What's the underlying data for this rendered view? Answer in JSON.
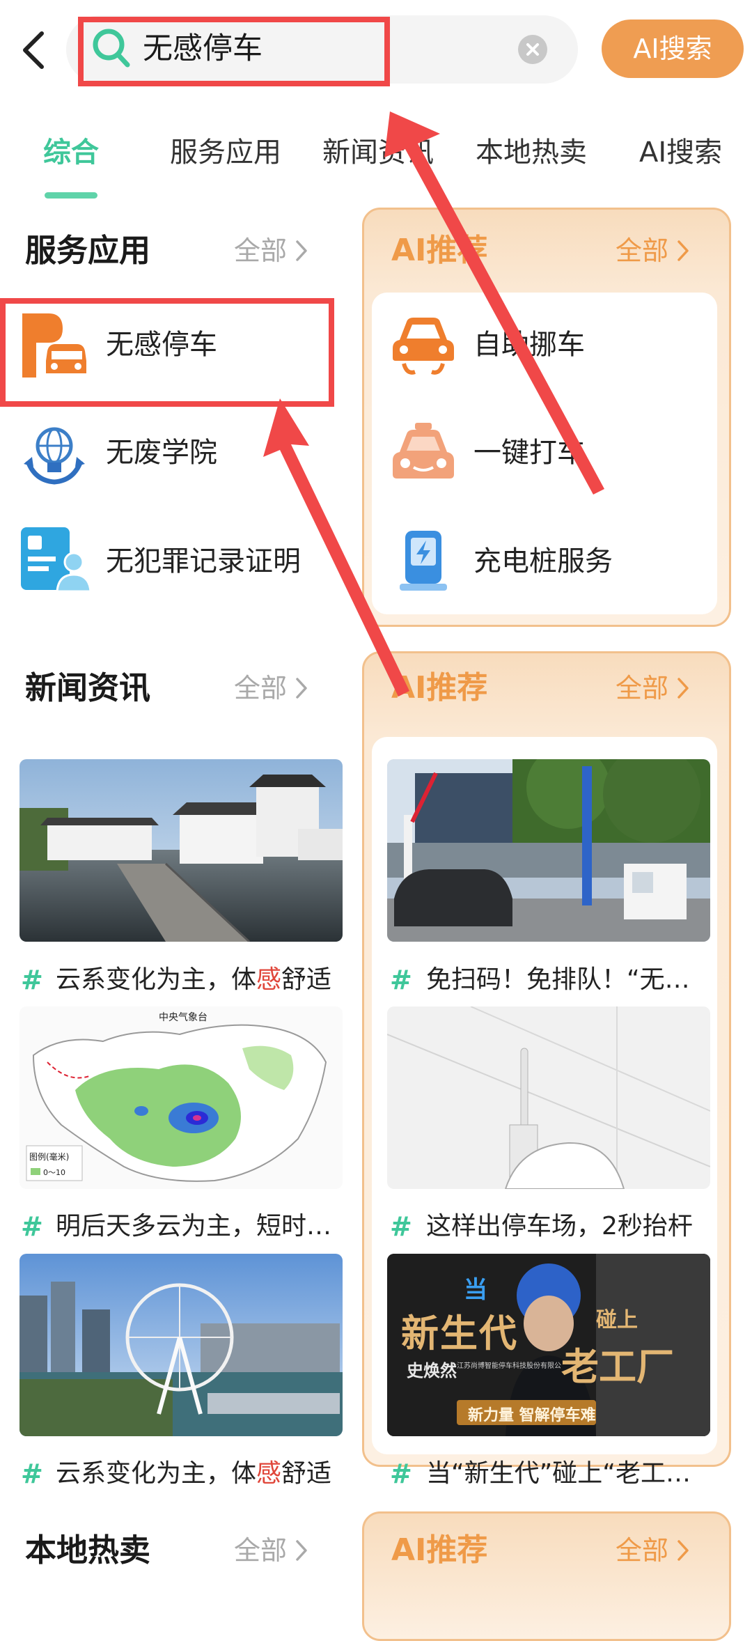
{
  "search": {
    "query": "无感停车",
    "ai_search_label": "AI搜索"
  },
  "tabs": [
    {
      "label": "综合",
      "active": true
    },
    {
      "label": "服务应用"
    },
    {
      "label": "新闻资讯"
    },
    {
      "label": "本地热卖"
    },
    {
      "label": "AI搜索"
    }
  ],
  "all_label": "全部",
  "service": {
    "title": "服务应用",
    "items": [
      {
        "label": "无感停车",
        "icon": "parking-car-icon"
      },
      {
        "label": "无废学院",
        "icon": "recycle-globe-icon"
      },
      {
        "label": "无犯罪记录证明",
        "icon": "id-card-icon"
      }
    ]
  },
  "ai_recommend": {
    "title": "AI推荐",
    "service_items": [
      {
        "label": "自助挪车",
        "icon": "tow-car-icon"
      },
      {
        "label": "一键打车",
        "icon": "taxi-icon"
      },
      {
        "label": "充电桩服务",
        "icon": "charging-pile-icon"
      }
    ],
    "news": [
      {
        "title": "免扫码！免排队！“无感…"
      },
      {
        "title": "这样出停车场，2秒抬杆"
      },
      {
        "title": "当“新生代”碰上“老工厂”…"
      }
    ],
    "poster": {
      "line1": "当",
      "line2": "新生代",
      "line3": "碰上",
      "line4": "老工厂",
      "name": "史焕然",
      "company": "江苏尚博智能停车科技股份有限公司",
      "brand": "新力量 智解停车难"
    }
  },
  "news": {
    "title": "新闻资讯",
    "items": [
      {
        "title_pre": "云系变化为主，体",
        "title_hl": "感",
        "title_post": "舒适"
      },
      {
        "title_pre": "明后天多云为主，短时…",
        "title_hl": "",
        "title_post": ""
      },
      {
        "title_pre": "云系变化为主，体",
        "title_hl": "感",
        "title_post": "舒适"
      }
    ],
    "map": {
      "org": "中央气象台",
      "legend_title": "图例(毫米)",
      "legend_item": "0～10"
    }
  },
  "local": {
    "title": "本地热卖"
  },
  "colors": {
    "accent_green": "#3fc79a",
    "accent_orange": "#ef9d52",
    "annotation_red": "#f04848"
  }
}
